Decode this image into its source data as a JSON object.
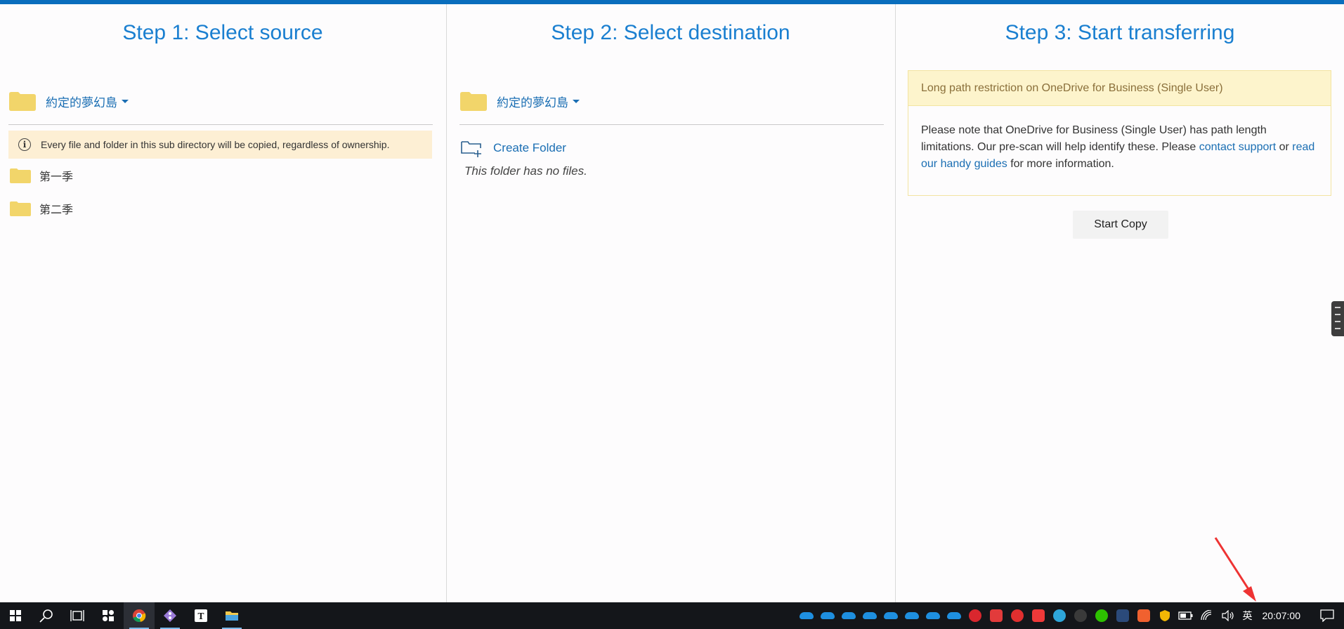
{
  "steps": {
    "step1": {
      "title": "Step 1: Select source",
      "breadcrumb": "約定的夢幻島"
    },
    "step2": {
      "title": "Step 2: Select destination",
      "breadcrumb": "約定的夢幻島"
    },
    "step3": {
      "title": "Step 3: Start transferring"
    }
  },
  "source": {
    "notice": "Every file and folder in this sub directory will be copied, regardless of ownership.",
    "folders": [
      "第一季",
      "第二季"
    ]
  },
  "destination": {
    "create_folder_label": "Create Folder",
    "empty_text": "This folder has no files."
  },
  "transfer": {
    "warning_title": "Long path restriction on OneDrive for Business (Single User)",
    "warning_text_1": "Please note that OneDrive for Business (Single User) has path length limitations. Our pre-scan will help identify these. Please ",
    "contact_link": "contact support",
    "warning_text_2": "or ",
    "guides_link": "read our handy guides",
    "warning_text_3": " for more information.",
    "start_button": "Start Copy"
  },
  "taskbar": {
    "apps": [
      "start-icon",
      "search-icon",
      "task-view-icon",
      "app-icon",
      "chrome-icon",
      "git-icon",
      "typora-icon",
      "file-explorer-icon"
    ],
    "tray_icons": [
      "onedrive-icon",
      "onedrive-icon",
      "onedrive-icon",
      "onedrive-icon",
      "onedrive-icon",
      "onedrive-icon",
      "onedrive-icon",
      "onedrive-icon",
      "huawei-icon",
      "app-red-icon",
      "netease-icon",
      "vivaldi-icon",
      "telegram-icon",
      "music-icon",
      "wechat-icon",
      "app-dark-icon",
      "app-orange-icon",
      "shield-icon",
      "battery-icon",
      "wifi-icon",
      "volume-icon"
    ],
    "ime": "英",
    "clock": "20:07:00"
  },
  "colors": {
    "accent": "#1a7fd0",
    "link": "#1a6eb3",
    "folder": "#f2d56a",
    "notice_bg": "#fdefd4",
    "warning_bg": "#fdf4cc",
    "taskbar": "#14161a"
  }
}
